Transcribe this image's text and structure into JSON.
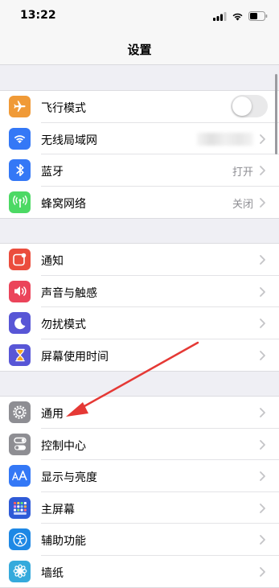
{
  "status": {
    "time": "13:22"
  },
  "nav": {
    "title": "设置"
  },
  "groups": [
    {
      "items": [
        {
          "label": "飞行模式",
          "icon": "airplane-icon",
          "color": "#f09a37",
          "accessory": "toggle",
          "value": ""
        },
        {
          "label": "无线局域网",
          "icon": "wifi-icon",
          "color": "#3478f6",
          "accessory": "chevron",
          "value": ""
        },
        {
          "label": "蓝牙",
          "icon": "bluetooth-icon",
          "color": "#3478f6",
          "accessory": "chevron",
          "value": "打开"
        },
        {
          "label": "蜂窝网络",
          "icon": "cellular-icon",
          "color": "#4cd964",
          "accessory": "chevron",
          "value": "关闭"
        }
      ]
    },
    {
      "items": [
        {
          "label": "通知",
          "icon": "notifications-icon",
          "color": "#eb4d3d",
          "accessory": "chevron",
          "value": ""
        },
        {
          "label": "声音与触感",
          "icon": "speaker-icon",
          "color": "#eb445a",
          "accessory": "chevron",
          "value": ""
        },
        {
          "label": "勿扰模式",
          "icon": "moon-icon",
          "color": "#5856d6",
          "accessory": "chevron",
          "value": ""
        },
        {
          "label": "屏幕使用时间",
          "icon": "hourglass-icon",
          "color": "#5856d6",
          "accessory": "chevron",
          "value": ""
        }
      ]
    },
    {
      "items": [
        {
          "label": "通用",
          "icon": "gear-icon",
          "color": "#8e8e93",
          "accessory": "chevron",
          "value": ""
        },
        {
          "label": "控制中心",
          "icon": "switches-icon",
          "color": "#8e8e93",
          "accessory": "chevron",
          "value": ""
        },
        {
          "label": "显示与亮度",
          "icon": "text-size-icon",
          "color": "#3478f6",
          "accessory": "chevron",
          "value": ""
        },
        {
          "label": "主屏幕",
          "icon": "home-screen-icon",
          "color": "#2f5bd7",
          "accessory": "chevron",
          "value": ""
        },
        {
          "label": "辅助功能",
          "icon": "accessibility-icon",
          "color": "#1e88e5",
          "accessory": "chevron",
          "value": ""
        },
        {
          "label": "墙纸",
          "icon": "flower-icon",
          "color": "#35aadc",
          "accessory": "chevron",
          "value": ""
        }
      ]
    }
  ],
  "annotation": {
    "color": "#e53935"
  }
}
